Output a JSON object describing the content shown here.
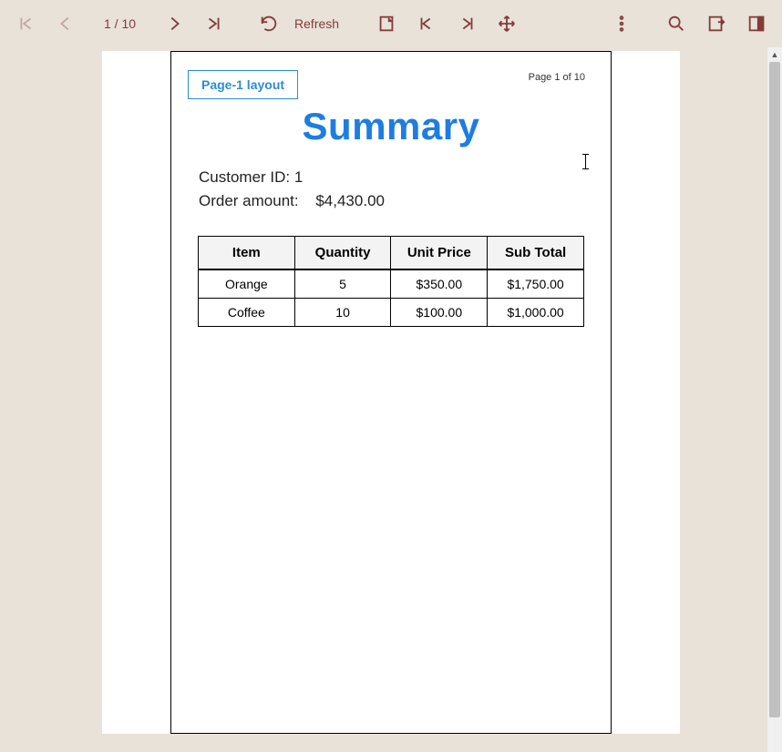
{
  "toolbar": {
    "page_indicator": "1 / 10",
    "refresh_label": "Refresh"
  },
  "report": {
    "layout_tag": "Page-1 layout",
    "page_num_text": "Page 1 of 10",
    "title": "Summary",
    "customer_id_label": "Customer ID: 1",
    "order_amount_label": "Order amount:",
    "order_amount_value": "$4,430.00",
    "table": {
      "headers": [
        "Item",
        "Quantity",
        "Unit Price",
        "Sub Total"
      ],
      "rows": [
        {
          "item": "Orange",
          "qty": "5",
          "price": "$350.00",
          "sub": "$1,750.00"
        },
        {
          "item": "Coffee",
          "qty": "10",
          "price": "$100.00",
          "sub": "$1,000.00"
        }
      ]
    }
  }
}
